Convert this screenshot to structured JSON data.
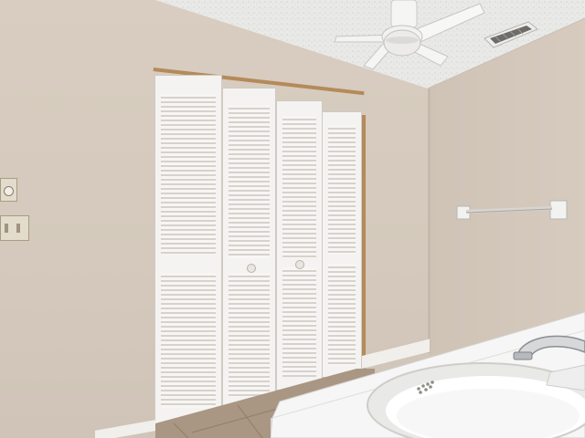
{
  "scene": {
    "kind": "photo",
    "subject": "bathroom",
    "colors": {
      "wall": "#d6cbbe",
      "ceiling": "#e8e8e6",
      "door": "#f4f3f1",
      "floor": "#a99683",
      "counter": "#f6f6f6",
      "trim": "#b58a5a"
    },
    "icons": [
      "ceiling-fan-icon",
      "air-vent-icon",
      "towel-bar-icon",
      "faucet-icon",
      "sink-icon",
      "light-switch-icon",
      "dimmer-icon"
    ]
  }
}
